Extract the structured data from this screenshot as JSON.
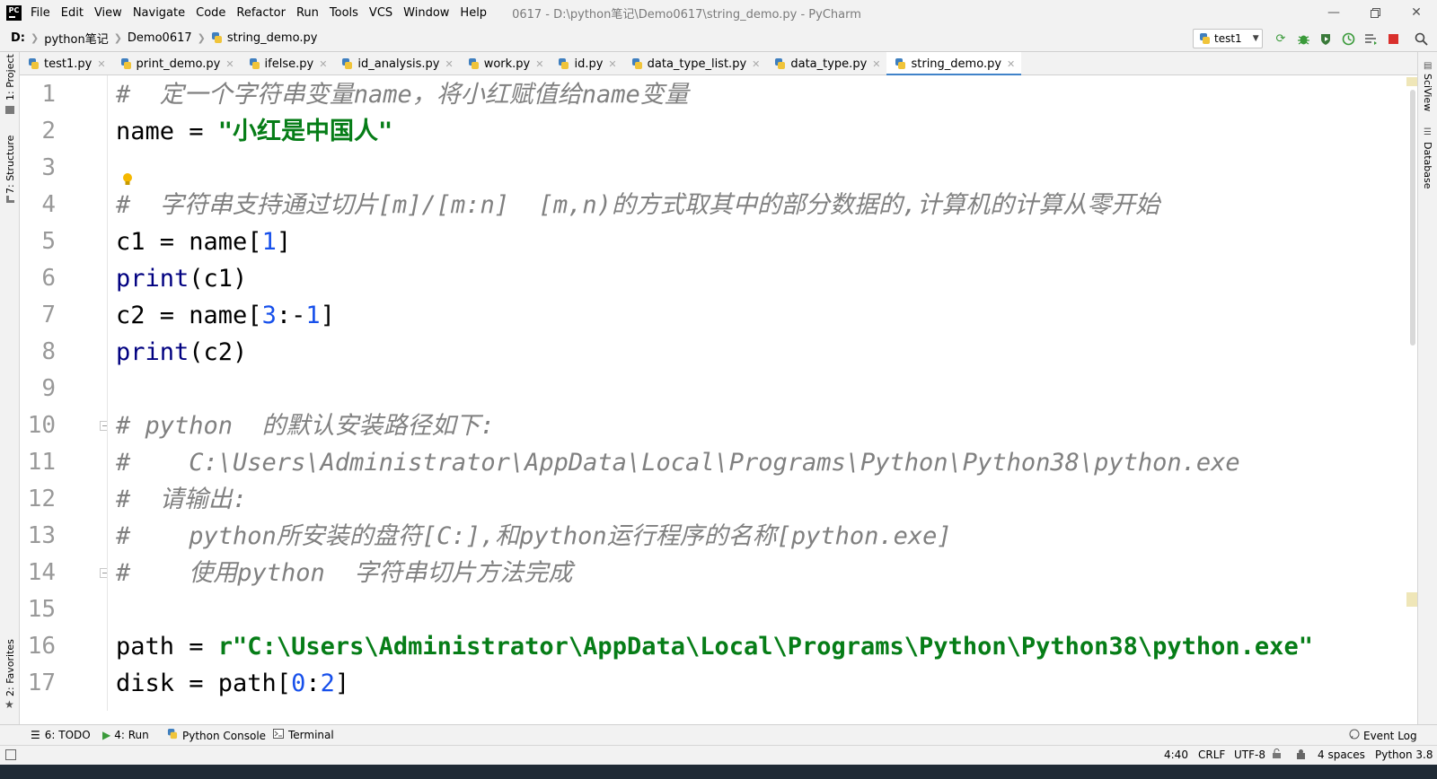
{
  "titlebar": {
    "logo": "PC",
    "menu": [
      "File",
      "Edit",
      "View",
      "Navigate",
      "Code",
      "Refactor",
      "Run",
      "Tools",
      "VCS",
      "Window",
      "Help"
    ],
    "window_title": "0617 - D:\\python笔记\\Demo0617\\string_demo.py - PyCharm"
  },
  "navbar": {
    "breadcrumbs": [
      "D:",
      "python笔记",
      "Demo0617",
      "string_demo.py"
    ],
    "run_config": "test1"
  },
  "tabs": [
    {
      "label": "test1.py",
      "active": false
    },
    {
      "label": "print_demo.py",
      "active": false
    },
    {
      "label": "ifelse.py",
      "active": false
    },
    {
      "label": "id_analysis.py",
      "active": false
    },
    {
      "label": "work.py",
      "active": false
    },
    {
      "label": "id.py",
      "active": false
    },
    {
      "label": "data_type_list.py",
      "active": false
    },
    {
      "label": "data_type.py",
      "active": false
    },
    {
      "label": "string_demo.py",
      "active": true
    }
  ],
  "left_strip": {
    "project": "1: Project",
    "structure": "7: Structure",
    "favorites": "2: Favorites"
  },
  "right_strip": {
    "sciview": "SciView",
    "database": "Database"
  },
  "editor": {
    "line_numbers": [
      "1",
      "2",
      "3",
      "4",
      "5",
      "6",
      "7",
      "8",
      "9",
      "10",
      "11",
      "12",
      "13",
      "14",
      "15",
      "16",
      "17"
    ],
    "lines": {
      "l1": "#  定一个字符串变量name，将小红赋值给name变量",
      "l2_var": "name = ",
      "l2_str": "\"小红是中国人\"",
      "l4": "#  字符串支持通过切片[m]/[m:n]  [m,n)的方式取其中的部分数据的,计算机的计算从零开始",
      "l5_a": "c1 = name[",
      "l5_n": "1",
      "l5_b": "]",
      "l6_fn": "print",
      "l6_rest": "(c1)",
      "l7_a": "c2 = name[",
      "l7_n1": "3",
      "l7_c": ":-",
      "l7_n2": "1",
      "l7_b": "]",
      "l8_fn": "print",
      "l8_rest": "(c2)",
      "l10": "# python  的默认安装路径如下:",
      "l11": "#    C:\\Users\\Administrator\\AppData\\Local\\Programs\\Python\\Python38\\python.exe",
      "l12": "#  请输出:",
      "l13": "#    python所安装的盘符[C:],和python运行程序的名称[python.exe]",
      "l14": "#    使用python  字符串切片方法完成",
      "l16_var": "path = ",
      "l16_str": "r\"C:\\Users\\Administrator\\AppData\\Local\\Programs\\Python\\Python38\\python.exe\"",
      "l17_a": "disk = path[",
      "l17_n1": "0",
      "l17_c": ":",
      "l17_n2": "2",
      "l17_b": "]"
    }
  },
  "bottom_tools": {
    "todo": "6: TODO",
    "run": "4: Run",
    "console": "Python Console",
    "terminal": "Terminal",
    "event_log": "Event Log"
  },
  "statusbar": {
    "position": "4:40",
    "line_sep": "CRLF",
    "encoding": "UTF-8",
    "indent": "4 spaces",
    "interpreter": "Python 3.8"
  },
  "colors": {
    "comment": "#808080",
    "string": "#067d17",
    "number": "#1750eb",
    "builtin": "#000080",
    "active_tab_underline": "#4083c9",
    "current_line": "#fcfaed"
  }
}
